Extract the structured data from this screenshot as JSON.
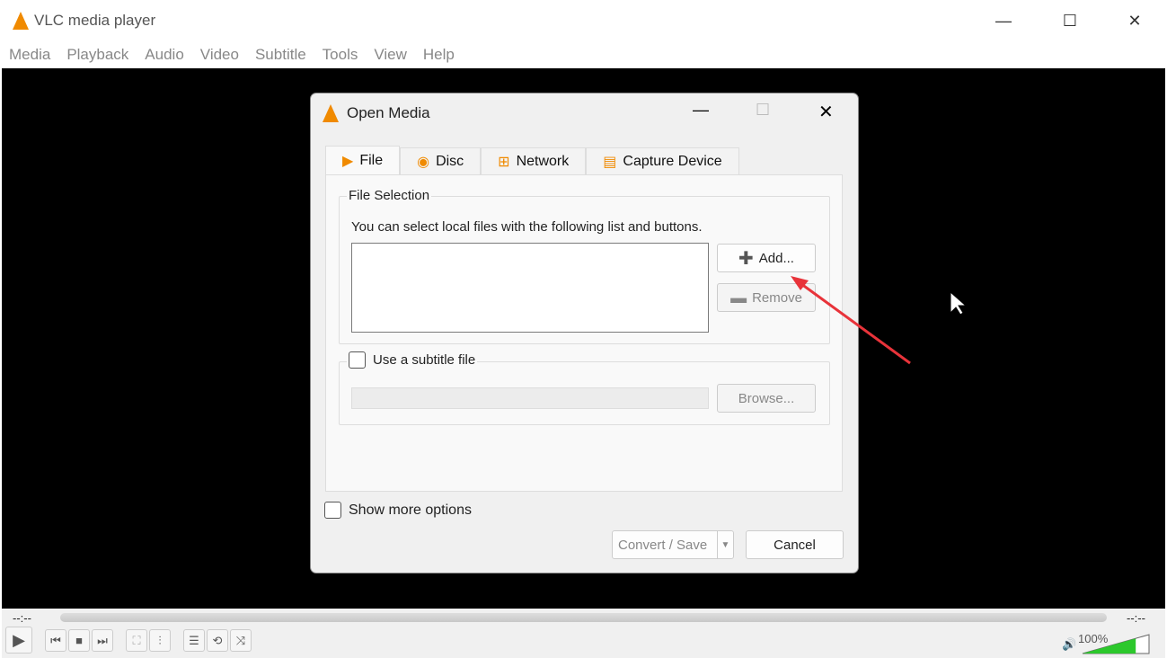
{
  "window": {
    "title": "VLC media player",
    "minimize": "—",
    "maximize": "☐",
    "close": "✕"
  },
  "menu": [
    "Media",
    "Playback",
    "Audio",
    "Video",
    "Subtitle",
    "Tools",
    "View",
    "Help"
  ],
  "dialog": {
    "title": "Open Media",
    "tabs": [
      "File",
      "Disc",
      "Network",
      "Capture Device"
    ],
    "file_selection": {
      "label": "File Selection",
      "hint": "You can select local files with the following list and buttons.",
      "add": "Add...",
      "remove": "Remove"
    },
    "subtitle": {
      "label": "Use a subtitle file",
      "browse": "Browse..."
    },
    "show_more": "Show more options",
    "convert": "Convert / Save",
    "cancel": "Cancel"
  },
  "player": {
    "elapsed": "--:--",
    "remaining": "--:--",
    "volume_label": "100%",
    "volume": 1.0,
    "accent": "#f08a00"
  }
}
